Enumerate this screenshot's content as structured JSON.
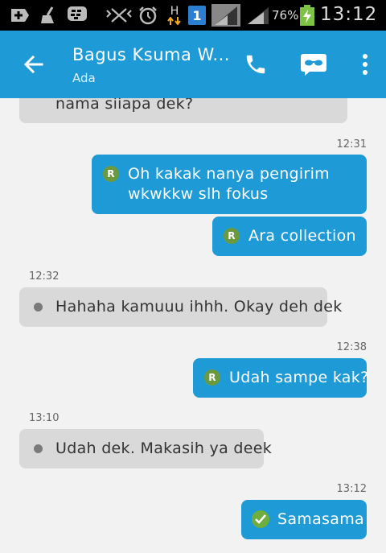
{
  "status_bar": {
    "battery_percent": "76%",
    "time": "13:12",
    "network_label": "H",
    "sim_slot": "1",
    "icons": [
      "add-icon",
      "broom-icon",
      "bbm-icon",
      "vibrate-icon",
      "alarm-icon",
      "data-h-icon",
      "sim1-icon",
      "signal-icon",
      "signal-icon-2",
      "battery-charging-icon"
    ]
  },
  "header": {
    "contact_name": "Bagus Ksuma W...",
    "contact_status": "Ada",
    "colors": {
      "bar": "#1e9bd7"
    }
  },
  "messages": [
    {
      "direction": "in",
      "text": "nama siiapa dek?"
    },
    {
      "time": "12:31",
      "align": "right"
    },
    {
      "direction": "out",
      "badge": "R",
      "lines": [
        "Oh kakak nanya pengirim",
        "wkwkkw slh fokus"
      ]
    },
    {
      "direction": "out",
      "badge": "R",
      "text": "Ara collection"
    },
    {
      "time": "12:32",
      "align": "left"
    },
    {
      "direction": "in",
      "text": "Hahaha kamuuu ihhh. Okay deh dek"
    },
    {
      "time": "12:38",
      "align": "right"
    },
    {
      "direction": "out",
      "badge": "R",
      "text": "Udah sampe kak?"
    },
    {
      "time": "13:10",
      "align": "left"
    },
    {
      "direction": "in",
      "text": "Udah dek. Makasih ya deek"
    },
    {
      "time": "13:12",
      "align": "right"
    },
    {
      "direction": "out",
      "badge": "check",
      "text": "Samasama"
    }
  ]
}
